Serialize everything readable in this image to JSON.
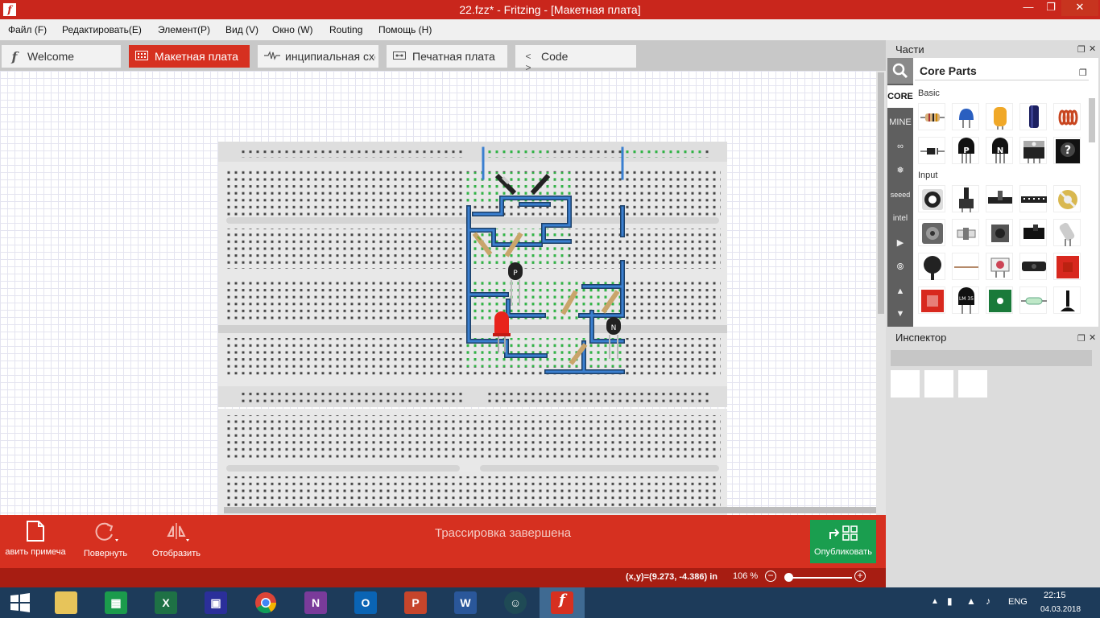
{
  "window": {
    "title": "22.fzz* - Fritzing - [Макетная плата]"
  },
  "menu": [
    "Файл (F)",
    "Редактировать(E)",
    "Элемент(P)",
    "Вид (V)",
    "Окно (W)",
    "Routing",
    "Помощь (H)"
  ],
  "tabs": [
    {
      "label": "Welcome",
      "icon": "fritzing-f-icon"
    },
    {
      "label": "Макетная плата",
      "icon": "breadboard-icon",
      "active": true
    },
    {
      "label": "инципиальная схе",
      "icon": "schematic-icon"
    },
    {
      "label": "Печатная плата",
      "icon": "pcb-icon"
    },
    {
      "label": "Code",
      "icon": "code-icon"
    }
  ],
  "canvas": {
    "logo": "fritzing"
  },
  "toolbar": {
    "add_note": "авить примеча",
    "rotate": "Повернуть",
    "flip": "Отобразить",
    "status": "Трассировка завершена",
    "publish": "Опубликовать"
  },
  "statusbar": {
    "coords": "(x,y)=(9.273, -4.386) in",
    "zoom": "106 %"
  },
  "parts_panel": {
    "title": "Части",
    "bin_title": "Core Parts",
    "bins": [
      "CORE",
      "MINE"
    ],
    "sections": [
      "Basic",
      "Input"
    ],
    "basic_parts": [
      "resistor",
      "ceramic-capacitor",
      "electrolytic-capacitor",
      "electrolytic-capacitor-large",
      "inductor",
      "diode",
      "pnp-transistor",
      "npn-transistor",
      "fet-transistor",
      "mystery-part"
    ],
    "basic_badges": [
      "P",
      "N",
      "?"
    ],
    "input_parts": [
      "potentiometer",
      "rotary-potentiometer",
      "slide-potentiometer",
      "dip-switch",
      "trimmer",
      "stepper",
      "toggle-switch",
      "pushbutton",
      "slide-switch",
      "tilt-sensor",
      "fsr",
      "flex-sensor",
      "sensor-board",
      "ir-receiver",
      "breakout-board",
      "red-board",
      "temperature-sensor",
      "green-board",
      "reed-switch",
      "joystick"
    ],
    "temperature_sensor_label": "LM 35"
  },
  "inspector": {
    "title": "Инспектор"
  },
  "taskbar": {
    "apps": [
      "start",
      "file-explorer",
      "store",
      "excel",
      "save-app",
      "chrome",
      "onenote",
      "outlook",
      "powerpoint",
      "word",
      "android-app",
      "fritzing"
    ],
    "app_letters": {
      "excel": "X",
      "onenote": "N",
      "outlook": "O",
      "powerpoint": "P",
      "word": "W",
      "fritzing": "f"
    },
    "lang": "ENG",
    "time": "22:15",
    "date": "04.03.2018"
  },
  "colors": {
    "accent": "#d63020",
    "publish": "#1a9e4f",
    "wire": "#3a7fd0",
    "led": "#e8231b"
  }
}
